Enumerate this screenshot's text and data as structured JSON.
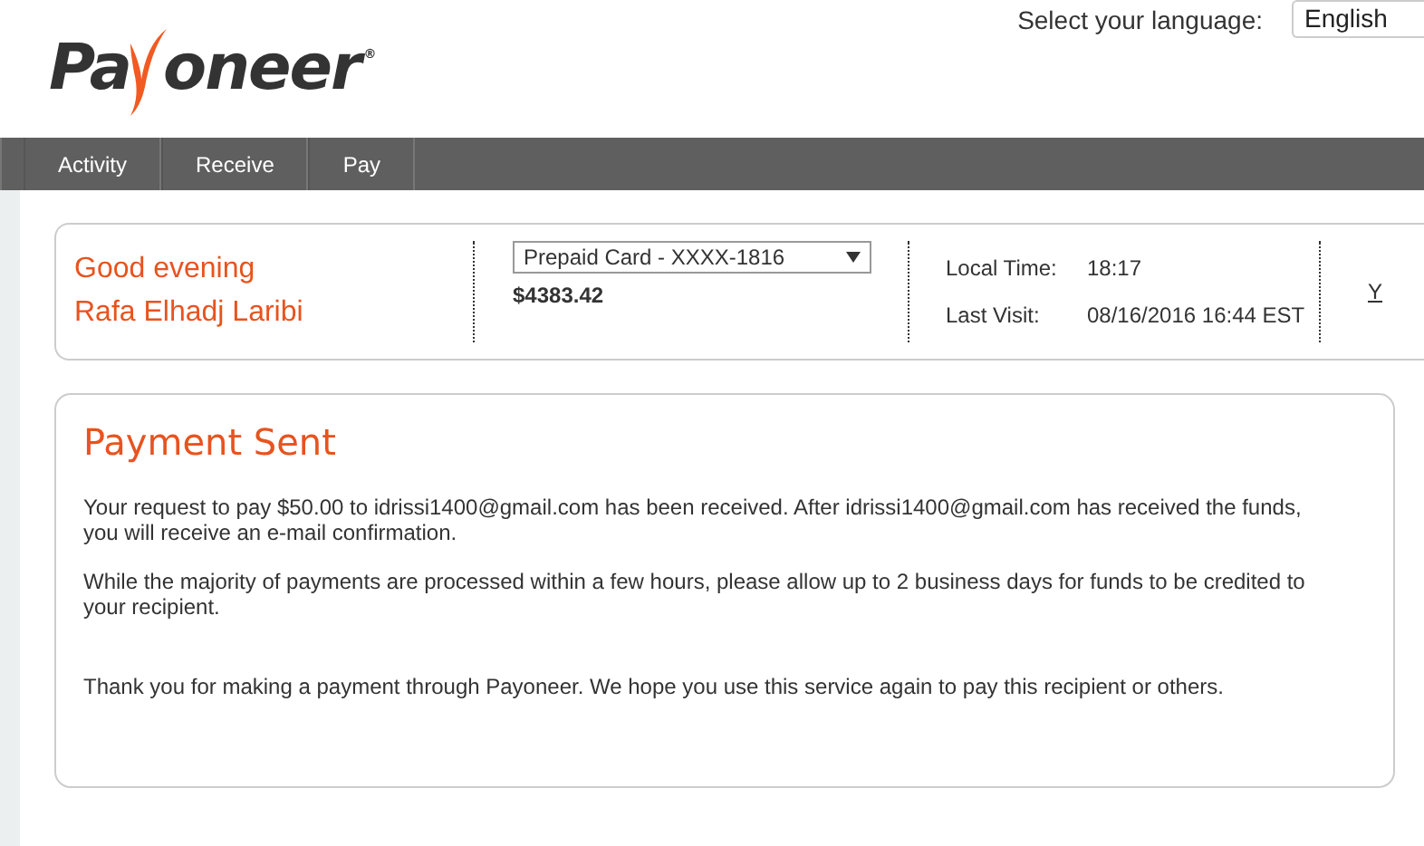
{
  "logo": {
    "before": "Pa",
    "after": "oneer",
    "mark": "®"
  },
  "language": {
    "label": "Select your language:",
    "value": "English"
  },
  "nav": [
    {
      "label": "Activity"
    },
    {
      "label": "Receive"
    },
    {
      "label": "Pay"
    }
  ],
  "summary": {
    "greeting": "Good evening",
    "name": "Rafa Elhadj Laribi",
    "account": "Prepaid Card - XXXX-1816",
    "balance": "$4383.42",
    "local_time_label": "Local Time:",
    "local_time": "18:17",
    "last_visit_label": "Last Visit:",
    "last_visit": "08/16/2016 16:44 EST",
    "link": "Y"
  },
  "message": {
    "title": "Payment Sent",
    "paragraphs": [
      "Your request to pay $50.00 to idrissi1400@gmail.com has been received. After idrissi1400@gmail.com has received the funds, you will receive an e-mail confirmation.",
      "While the majority of payments are processed within a few hours, please allow up to 2 business days for funds to be credited to your recipient.",
      "Thank you for making a payment through Payoneer. We hope you use this service again to pay this recipient or others."
    ]
  }
}
